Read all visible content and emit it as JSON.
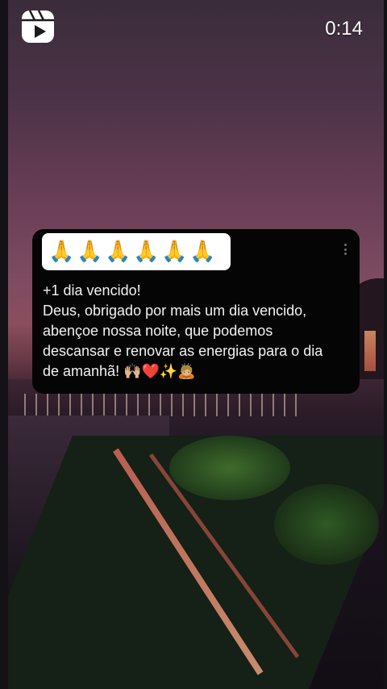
{
  "reel": {
    "icon": "reels-icon",
    "timer": "0:14"
  },
  "post": {
    "emoji_header": [
      "🙏",
      "🙏",
      "🙏",
      "🙏",
      "🙏",
      "🙏"
    ],
    "menu_icon": "more-vertical-icon",
    "lines": [
      "+1 dia vencido!",
      "Deus, obrigado por mais um dia vencido,",
      "abençoe nossa noite, que podemos",
      "descansar e renovar as energias para o dia",
      "de amanhã! 🙌🏼❤️✨🙇🏼"
    ]
  },
  "colors": {
    "card_bg": "#050506",
    "text": "#f2f2f2",
    "emoji_box": "#ffffff"
  }
}
